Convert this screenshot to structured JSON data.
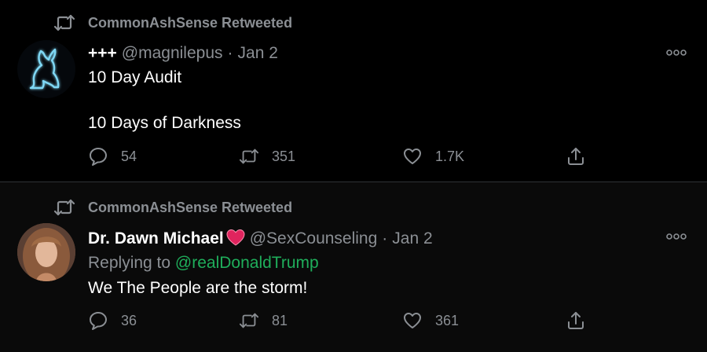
{
  "tweets": [
    {
      "retweeted_by": "CommonAshSense Retweeted",
      "display_name": "+++",
      "handle": "@magnilepus",
      "separator": "·",
      "date": "Jan 2",
      "replying_to_label": "",
      "replying_to_handle": "",
      "text": "10 Day Audit\n\n10 Days of Darkness",
      "replies": "54",
      "retweets": "351",
      "likes": "1.7K",
      "avatar_icon": "neon-rabbit-avatar"
    },
    {
      "retweeted_by": "CommonAshSense Retweeted",
      "display_name": "Dr. Dawn Michael",
      "name_emoji": "heart-emoji",
      "handle": "@SexCounseling",
      "separator": "·",
      "date": "Jan 2",
      "replying_to_label": "Replying to ",
      "replying_to_handle": "@realDonaldTrump",
      "text": "We The People are the storm!",
      "replies": "36",
      "retweets": "81",
      "likes": "361",
      "avatar_icon": "woman-photo-avatar"
    }
  ],
  "colors": {
    "background": "#000000",
    "muted": "#8b8f94",
    "text": "#ffffff",
    "mention": "#1fae5b",
    "heart": "#e0245e"
  }
}
